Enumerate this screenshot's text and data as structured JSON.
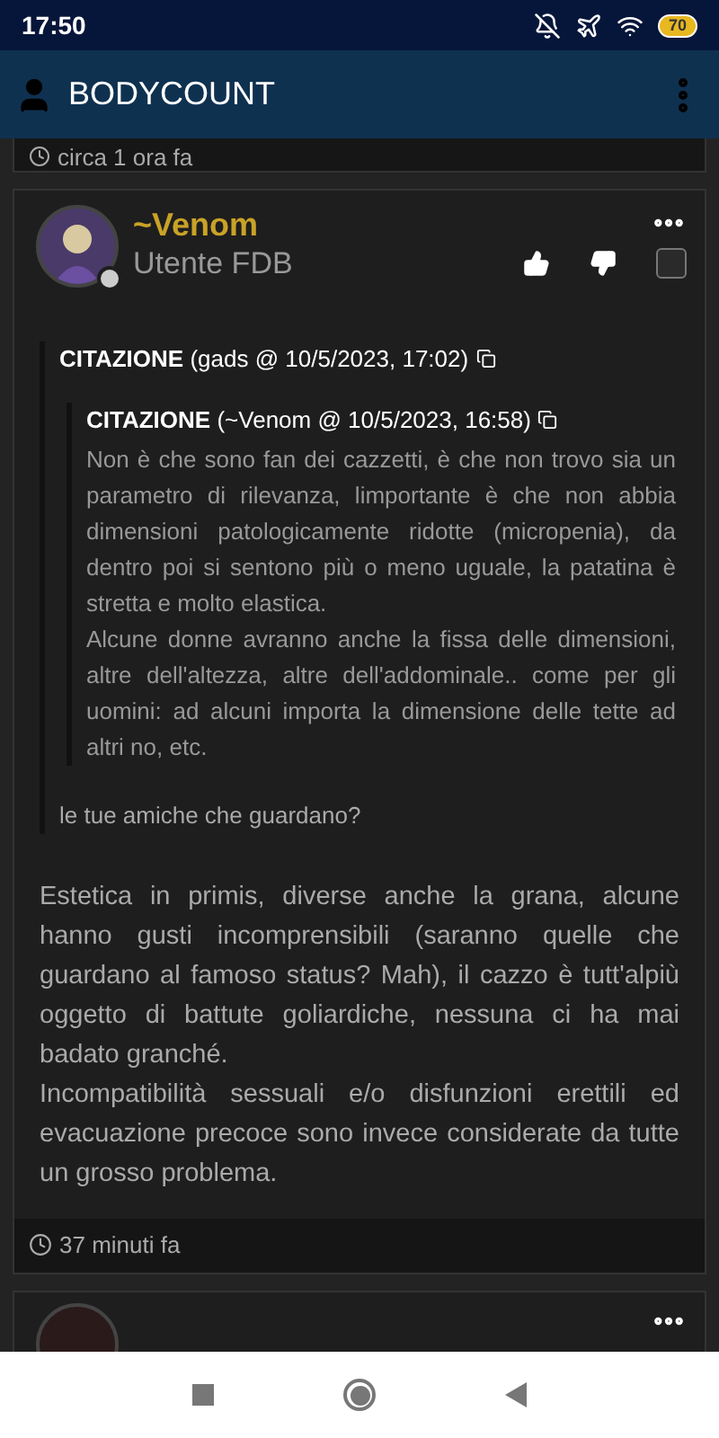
{
  "status_bar": {
    "time": "17:50",
    "battery": "70"
  },
  "app_bar": {
    "title": "BODYCOUNT"
  },
  "previous_post": {
    "timestamp": "circa 1 ora fa"
  },
  "post": {
    "username": "~Venom",
    "role": "Utente FDB",
    "checked": false,
    "quote": {
      "label": "CITAZIONE",
      "source": "(gads @ 10/5/2023, 17:02)",
      "nested": {
        "label": "CITAZIONE",
        "source": "(~Venom @ 10/5/2023, 16:58)",
        "paragraphs": [
          "Non è che sono fan dei cazzetti, è che non trovo sia un parametro di rilevanza, limportante è che non abbia dimensioni patologicamente ridotte (micropenia), da dentro poi si sentono più o meno uguale, la patatina è stretta e molto elastica.",
          "Alcune donne avranno anche la fissa delle dimensioni, altre dell'altezza, altre dell'addominale.. come per gli uomini: ad alcuni importa la dimensione delle tette ad altri no, etc."
        ]
      },
      "text": "le tue amiche che guardano?"
    },
    "body": [
      "Estetica in primis, diverse anche la grana, alcune hanno gusti incomprensibili (saranno quelle che guardano al famoso status? Mah), il cazzo è tutt'alpiù oggetto di battute goliardiche, nessuna ci ha mai badato granché.",
      "Incompatibilità sessuali e/o disfunzioni erettili ed evacuazione precoce sono invece considerate da tutte un grosso problema."
    ],
    "timestamp": "37 minuti fa"
  }
}
